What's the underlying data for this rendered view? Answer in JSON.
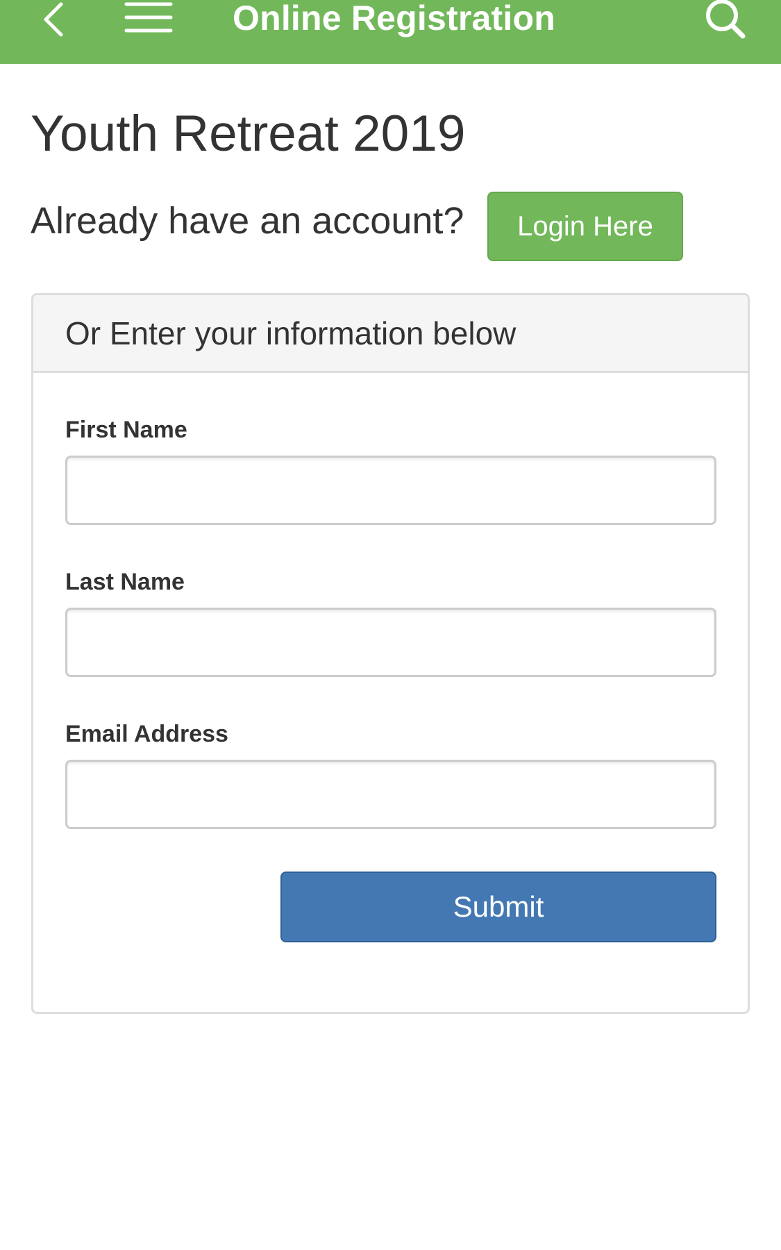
{
  "colors": {
    "header_bg": "#72b85a",
    "login_button_bg": "#72b85a",
    "submit_button_bg": "#4478b3",
    "panel_border": "#dddddd",
    "panel_heading_bg": "#f5f5f5",
    "text": "#333333"
  },
  "header": {
    "title": "Online Registration",
    "back_icon": "chevron-left-icon",
    "menu_icon": "hamburger-menu-icon",
    "search_icon": "search-icon"
  },
  "page": {
    "title": "Youth Retreat 2019",
    "account_prompt": "Already have an account?",
    "login_button_label": "Login Here"
  },
  "form": {
    "heading": "Or Enter your information below",
    "fields": [
      {
        "label": "First Name",
        "value": "",
        "placeholder": ""
      },
      {
        "label": "Last Name",
        "value": "",
        "placeholder": ""
      },
      {
        "label": "Email Address",
        "value": "",
        "placeholder": ""
      }
    ],
    "submit_label": "Submit"
  }
}
